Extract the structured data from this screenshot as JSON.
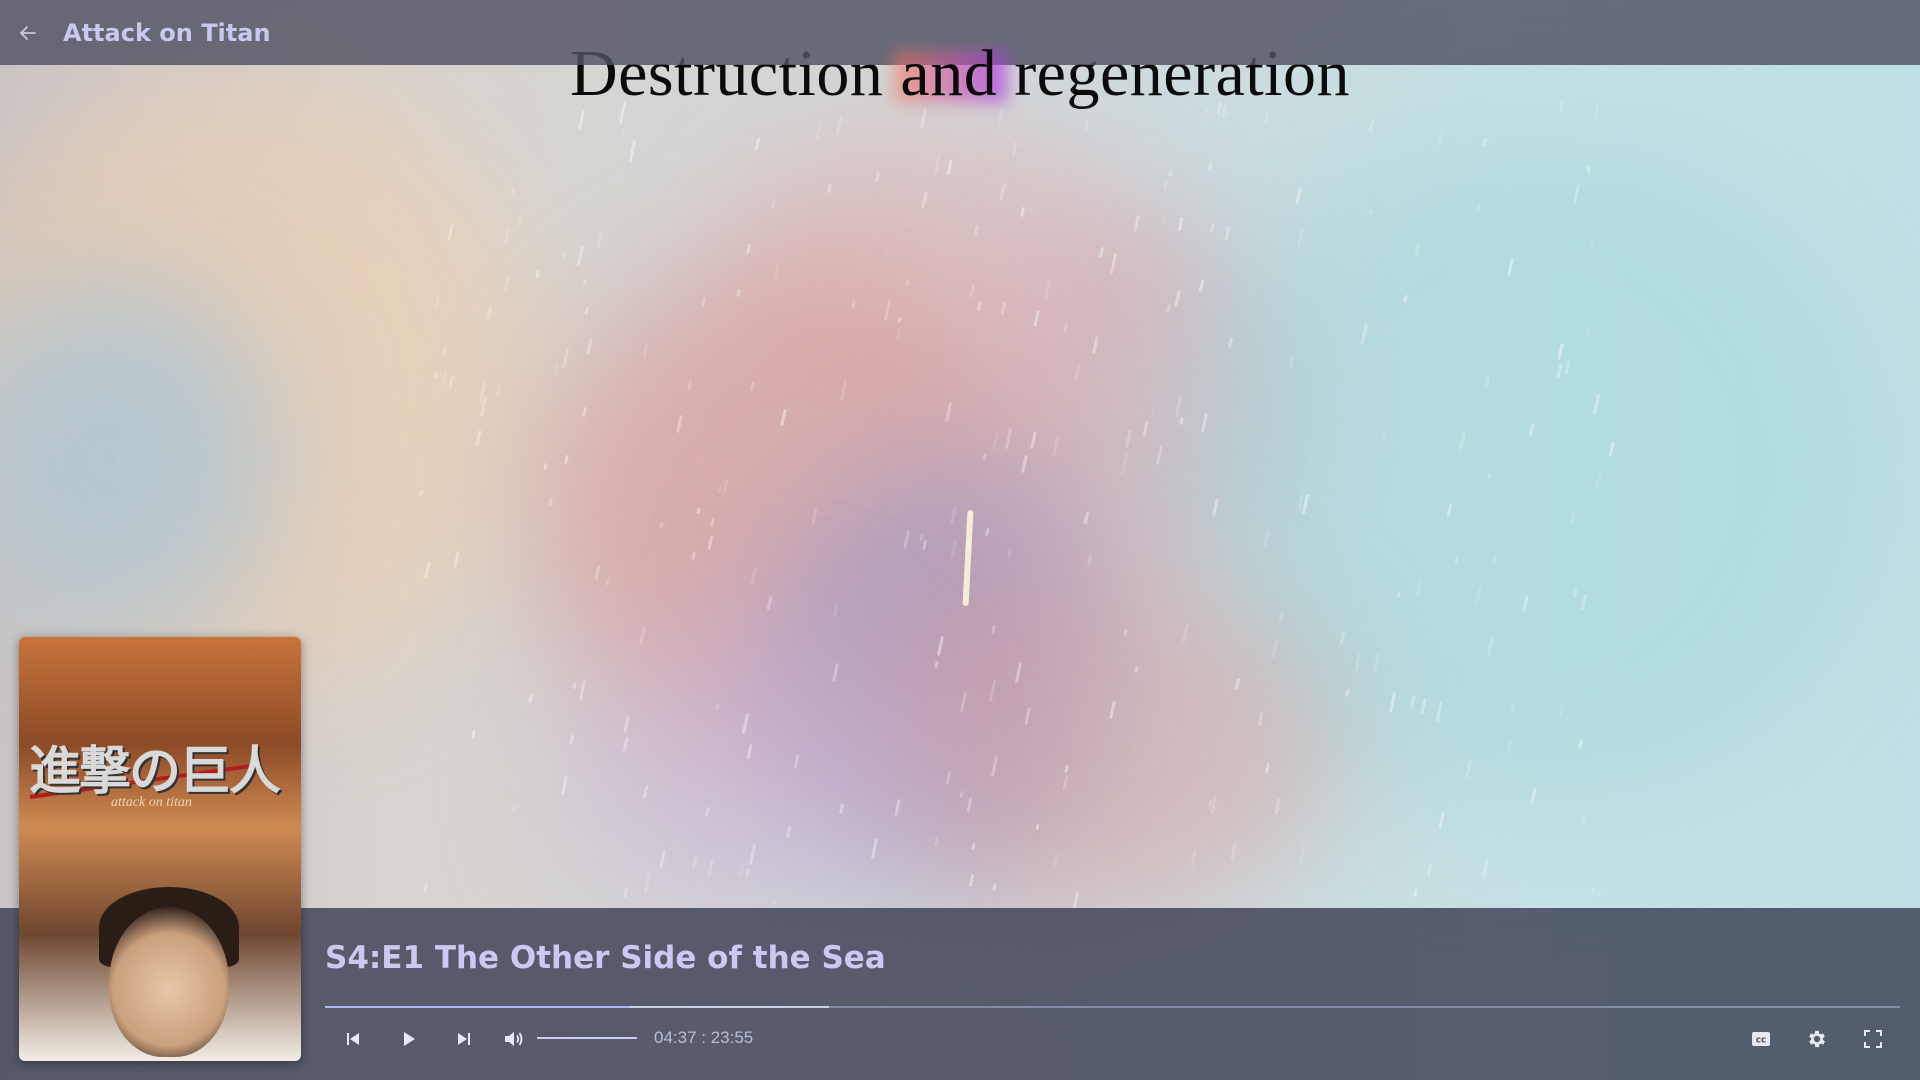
{
  "header": {
    "title": "Attack on Titan"
  },
  "caption": {
    "before": "Destruction ",
    "highlight": "and",
    "after": " regeneration"
  },
  "episode": {
    "title": "S4:E1 The Other Side of the Sea"
  },
  "playback": {
    "current": "04:37",
    "separator": " : ",
    "duration": "23:55",
    "played_fraction": 0.193,
    "buffered_fraction": 0.32,
    "volume_fraction": 1.0
  },
  "icons": {
    "back": "arrow-left-icon",
    "previous": "skip-previous-icon",
    "play": "play-icon",
    "next": "skip-next-icon",
    "volume": "volume-icon",
    "captions": "closed-captions-icon",
    "settings": "gear-icon",
    "fullscreen": "fullscreen-icon"
  },
  "colors": {
    "title_text": "#c8c8f0",
    "progress_played": "#a9b8f5",
    "bar_background": "#50526280"
  }
}
